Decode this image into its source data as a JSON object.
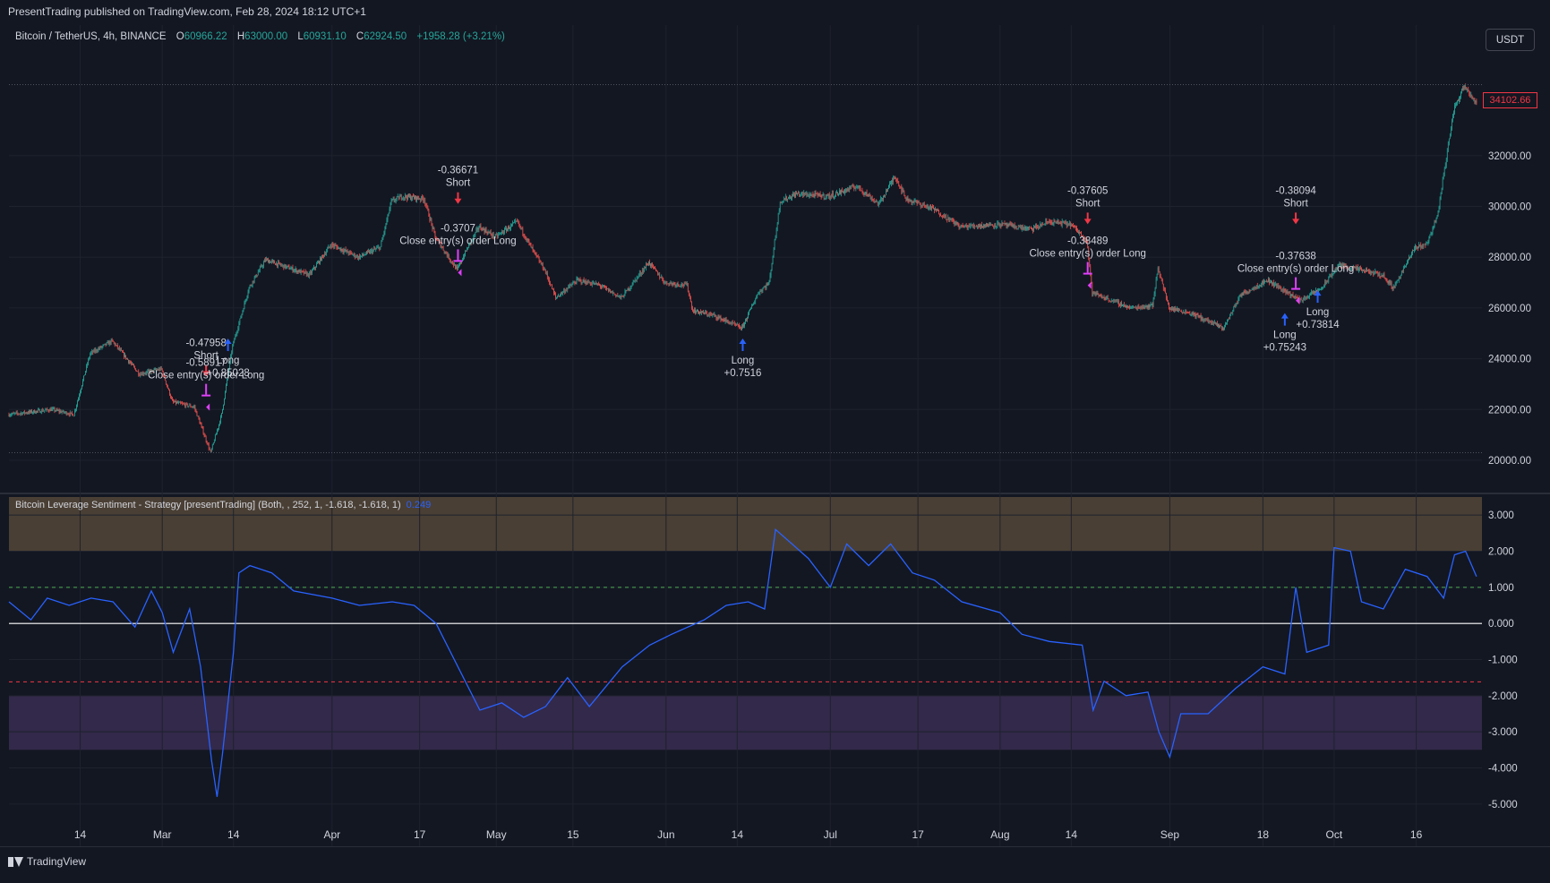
{
  "header": {
    "publish_text": "PresentTrading published on TradingView.com, Feb 28, 2024 18:12 UTC+1",
    "symbol": "Bitcoin / TetherUS, 4h, BINANCE",
    "o_label": "O",
    "o_value": "60966.22",
    "h_label": "H",
    "h_value": "63000.00",
    "l_label": "L",
    "l_value": "60931.10",
    "c_label": "C",
    "c_value": "62924.50",
    "change": "+1958.28 (+3.21%)",
    "currency_button": "USDT",
    "last_price": "34102.66"
  },
  "indicator": {
    "title": "Bitcoin Leverage Sentiment - Strategy [presentTrading] (Both, , 252, 1, -1.618, -1.618, 1)",
    "value": "0.249"
  },
  "footer": {
    "brand": "TradingView"
  },
  "colors": {
    "background": "#131722",
    "up_candle": "#26a69a",
    "down_candle": "#ef5350",
    "sentiment_line": "#2962ff",
    "short_arrow": "#f23645",
    "long_arrow": "#2962ff",
    "close_marker": "#e040fb",
    "upper_band": "#4a3f34",
    "lower_band": "#33294a"
  },
  "chart_data": [
    {
      "type": "candlestick",
      "timeframe": "4h",
      "ylim": [
        18800,
        36300
      ],
      "y_ticks": [
        20000,
        22000,
        24000,
        26000,
        28000,
        30000,
        32000
      ],
      "y_tick_labels": [
        "20000.00",
        "22000.00",
        "24000.00",
        "26000.00",
        "28000.00",
        "30000.00",
        "32000.00"
      ],
      "x_tick_labels": [
        "14",
        "Mar",
        "14",
        "Apr",
        "17",
        "May",
        "15",
        "Jun",
        "14",
        "Jul",
        "17",
        "Aug",
        "14",
        "Sep",
        "18",
        "Oct",
        "16"
      ],
      "x_tick_dates": [
        "2023-02-14",
        "2023-03-01",
        "2023-03-14",
        "2023-04-01",
        "2023-04-17",
        "2023-05-01",
        "2023-05-15",
        "2023-06-01",
        "2023-06-14",
        "2023-07-01",
        "2023-07-17",
        "2023-08-01",
        "2023-08-14",
        "2023-09-01",
        "2023-09-18",
        "2023-10-01",
        "2023-10-16"
      ],
      "price_path": [
        [
          "2023-02-01",
          21800
        ],
        [
          "2023-02-05",
          21900
        ],
        [
          "2023-02-09",
          22000
        ],
        [
          "2023-02-13",
          21800
        ],
        [
          "2023-02-16",
          24200
        ],
        [
          "2023-02-20",
          24700
        ],
        [
          "2023-02-25",
          23400
        ],
        [
          "2023-03-01",
          23600
        ],
        [
          "2023-03-03",
          22300
        ],
        [
          "2023-03-07",
          22100
        ],
        [
          "2023-03-10",
          20300
        ],
        [
          "2023-03-12",
          21800
        ],
        [
          "2023-03-14",
          24500
        ],
        [
          "2023-03-17",
          26800
        ],
        [
          "2023-03-20",
          27900
        ],
        [
          "2023-03-24",
          27600
        ],
        [
          "2023-03-28",
          27300
        ],
        [
          "2023-04-01",
          28500
        ],
        [
          "2023-04-06",
          28000
        ],
        [
          "2023-04-10",
          28400
        ],
        [
          "2023-04-12",
          30200
        ],
        [
          "2023-04-14",
          30400
        ],
        [
          "2023-04-18",
          30300
        ],
        [
          "2023-04-20",
          28800
        ],
        [
          "2023-04-24",
          27500
        ],
        [
          "2023-04-26",
          28400
        ],
        [
          "2023-04-28",
          29200
        ],
        [
          "2023-05-01",
          28800
        ],
        [
          "2023-05-05",
          29400
        ],
        [
          "2023-05-08",
          28200
        ],
        [
          "2023-05-10",
          27500
        ],
        [
          "2023-05-12",
          26400
        ],
        [
          "2023-05-16",
          27100
        ],
        [
          "2023-05-20",
          26900
        ],
        [
          "2023-05-24",
          26400
        ],
        [
          "2023-05-29",
          27800
        ],
        [
          "2023-06-01",
          27000
        ],
        [
          "2023-06-05",
          26900
        ],
        [
          "2023-06-06",
          25900
        ],
        [
          "2023-06-10",
          25700
        ],
        [
          "2023-06-15",
          25200
        ],
        [
          "2023-06-18",
          26600
        ],
        [
          "2023-06-20",
          27000
        ],
        [
          "2023-06-22",
          30200
        ],
        [
          "2023-06-25",
          30500
        ],
        [
          "2023-07-01",
          30400
        ],
        [
          "2023-07-06",
          30800
        ],
        [
          "2023-07-10",
          30100
        ],
        [
          "2023-07-13",
          31200
        ],
        [
          "2023-07-15",
          30300
        ],
        [
          "2023-07-20",
          29900
        ],
        [
          "2023-07-25",
          29200
        ],
        [
          "2023-08-01",
          29300
        ],
        [
          "2023-08-07",
          29100
        ],
        [
          "2023-08-10",
          29400
        ],
        [
          "2023-08-14",
          29300
        ],
        [
          "2023-08-17",
          28700
        ],
        [
          "2023-08-18",
          26600
        ],
        [
          "2023-08-25",
          26000
        ],
        [
          "2023-08-29",
          26100
        ],
        [
          "2023-08-30",
          27600
        ],
        [
          "2023-09-01",
          26000
        ],
        [
          "2023-09-05",
          25800
        ],
        [
          "2023-09-11",
          25200
        ],
        [
          "2023-09-14",
          26500
        ],
        [
          "2023-09-19",
          27100
        ],
        [
          "2023-09-25",
          26300
        ],
        [
          "2023-09-29",
          26800
        ],
        [
          "2023-10-02",
          27700
        ],
        [
          "2023-10-06",
          27500
        ],
        [
          "2023-10-10",
          27300
        ],
        [
          "2023-10-12",
          26800
        ],
        [
          "2023-10-16",
          28400
        ],
        [
          "2023-10-18",
          28500
        ],
        [
          "2023-10-20",
          29600
        ],
        [
          "2023-10-23",
          33800
        ],
        [
          "2023-10-25",
          34800
        ],
        [
          "2023-10-27",
          34100
        ]
      ],
      "trades": [
        {
          "date": "2023-03-09",
          "price": 23300,
          "side": "short",
          "value_label": "-0.47958",
          "label": "Short"
        },
        {
          "date": "2023-03-09",
          "price": 22800,
          "side": "close",
          "value_label": "-0.58917",
          "label": "Close entry(s) order Long"
        },
        {
          "date": "2023-03-13",
          "price": 24800,
          "side": "long",
          "value_label": "+0.85028",
          "label": "Long"
        },
        {
          "date": "2023-04-24",
          "price": 30100,
          "side": "short",
          "value_label": "-0.36671",
          "label": "Short"
        },
        {
          "date": "2023-04-24",
          "price": 28100,
          "side": "close",
          "value_label": "-0.3707",
          "label": "Close entry(s) order Long"
        },
        {
          "date": "2023-06-15",
          "price": 24800,
          "side": "long",
          "value_label": "+0.7516",
          "label": "Long"
        },
        {
          "date": "2023-08-17",
          "price": 29300,
          "side": "short",
          "value_label": "-0.37605",
          "label": "Short"
        },
        {
          "date": "2023-08-17",
          "price": 27600,
          "side": "close",
          "value_label": "-0.38489",
          "label": "Close entry(s) order Long"
        },
        {
          "date": "2023-09-24",
          "price": 29300,
          "side": "short",
          "value_label": "-0.38094",
          "label": "Short"
        },
        {
          "date": "2023-09-24",
          "price": 27000,
          "side": "close",
          "value_label": "-0.37638",
          "label": "Close entry(s) order Long"
        },
        {
          "date": "2023-09-22",
          "price": 25800,
          "side": "long",
          "value_label": "+0.75243",
          "label": "Long"
        },
        {
          "date": "2023-09-28",
          "price": 26700,
          "side": "long",
          "value_label": "+0.73814",
          "label": "Long"
        }
      ]
    },
    {
      "type": "line",
      "ylim": [
        -5.5,
        3.5
      ],
      "y_ticks": [
        3,
        2,
        1,
        0,
        -1,
        -2,
        -3,
        -4,
        -5
      ],
      "y_tick_labels": [
        "3.000",
        "2.000",
        "1.000",
        "0.000",
        "-1.000",
        "-2.000",
        "-3.000",
        "-4.000",
        "-5.000"
      ],
      "levels": {
        "upper_band": [
          2,
          3.5
        ],
        "lower_band": [
          -3.5,
          -2
        ],
        "zero": 0,
        "upper_dashed": 1,
        "lower_dashed": -1.618
      },
      "series": [
        {
          "values": [
            [
              "2023-02-01",
              0.6
            ],
            [
              "2023-02-05",
              0.1
            ],
            [
              "2023-02-08",
              0.7
            ],
            [
              "2023-02-12",
              0.5
            ],
            [
              "2023-02-16",
              0.7
            ],
            [
              "2023-02-20",
              0.6
            ],
            [
              "2023-02-24",
              -0.1
            ],
            [
              "2023-02-27",
              0.9
            ],
            [
              "2023-03-01",
              0.3
            ],
            [
              "2023-03-03",
              -0.8
            ],
            [
              "2023-03-06",
              0.4
            ],
            [
              "2023-03-08",
              -1.2
            ],
            [
              "2023-03-10",
              -3.8
            ],
            [
              "2023-03-11",
              -4.8
            ],
            [
              "2023-03-12",
              -3.6
            ],
            [
              "2023-03-14",
              -0.8
            ],
            [
              "2023-03-15",
              1.4
            ],
            [
              "2023-03-17",
              1.6
            ],
            [
              "2023-03-21",
              1.4
            ],
            [
              "2023-03-25",
              0.9
            ],
            [
              "2023-04-01",
              0.7
            ],
            [
              "2023-04-06",
              0.5
            ],
            [
              "2023-04-12",
              0.6
            ],
            [
              "2023-04-16",
              0.5
            ],
            [
              "2023-04-20",
              0.0
            ],
            [
              "2023-04-24",
              -1.2
            ],
            [
              "2023-04-28",
              -2.4
            ],
            [
              "2023-05-02",
              -2.2
            ],
            [
              "2023-05-06",
              -2.6
            ],
            [
              "2023-05-10",
              -2.3
            ],
            [
              "2023-05-14",
              -1.5
            ],
            [
              "2023-05-18",
              -2.3
            ],
            [
              "2023-05-24",
              -1.2
            ],
            [
              "2023-05-29",
              -0.6
            ],
            [
              "2023-06-02",
              -0.3
            ],
            [
              "2023-06-08",
              0.1
            ],
            [
              "2023-06-12",
              0.5
            ],
            [
              "2023-06-16",
              0.6
            ],
            [
              "2023-06-19",
              0.4
            ],
            [
              "2023-06-21",
              2.6
            ],
            [
              "2023-06-24",
              2.2
            ],
            [
              "2023-06-27",
              1.8
            ],
            [
              "2023-07-01",
              1.0
            ],
            [
              "2023-07-04",
              2.2
            ],
            [
              "2023-07-08",
              1.6
            ],
            [
              "2023-07-12",
              2.2
            ],
            [
              "2023-07-16",
              1.4
            ],
            [
              "2023-07-20",
              1.2
            ],
            [
              "2023-07-25",
              0.6
            ],
            [
              "2023-08-01",
              0.3
            ],
            [
              "2023-08-05",
              -0.3
            ],
            [
              "2023-08-10",
              -0.5
            ],
            [
              "2023-08-16",
              -0.6
            ],
            [
              "2023-08-18",
              -2.4
            ],
            [
              "2023-08-20",
              -1.6
            ],
            [
              "2023-08-24",
              -2.0
            ],
            [
              "2023-08-28",
              -1.9
            ],
            [
              "2023-08-30",
              -3.0
            ],
            [
              "2023-09-01",
              -3.7
            ],
            [
              "2023-09-03",
              -2.5
            ],
            [
              "2023-09-08",
              -2.5
            ],
            [
              "2023-09-13",
              -1.8
            ],
            [
              "2023-09-18",
              -1.2
            ],
            [
              "2023-09-22",
              -1.4
            ],
            [
              "2023-09-24",
              1.0
            ],
            [
              "2023-09-26",
              -0.8
            ],
            [
              "2023-09-30",
              -0.6
            ],
            [
              "2023-10-01",
              2.1
            ],
            [
              "2023-10-04",
              2.0
            ],
            [
              "2023-10-06",
              0.6
            ],
            [
              "2023-10-10",
              0.4
            ],
            [
              "2023-10-14",
              1.5
            ],
            [
              "2023-10-18",
              1.3
            ],
            [
              "2023-10-21",
              0.7
            ],
            [
              "2023-10-23",
              1.9
            ],
            [
              "2023-10-25",
              2.0
            ],
            [
              "2023-10-27",
              1.3
            ]
          ]
        }
      ]
    }
  ]
}
